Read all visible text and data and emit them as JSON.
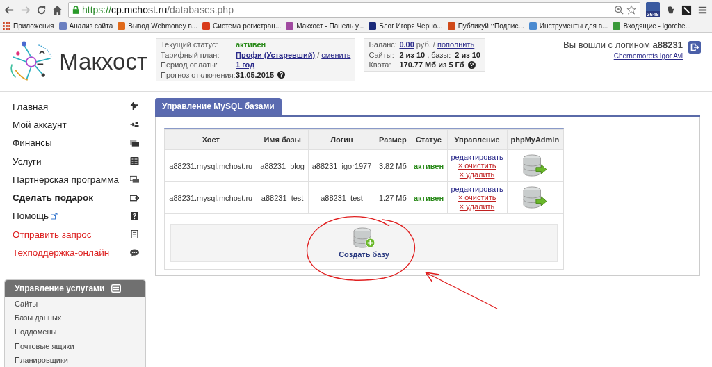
{
  "browser": {
    "url_scheme": "https://",
    "url_host": "cp.mchost.ru",
    "url_path": "/databases.php",
    "extension_badge": "2646",
    "bookmarks": [
      "Приложения",
      "Анализ сайта",
      "Вывод Webmoney в...",
      "Система регистрац...",
      "Макхост - Панель у...",
      "Блог Игоря Черно...",
      "Публикуй ::Подпис...",
      "Инструменты для в...",
      "Входящие - igorche..."
    ]
  },
  "header": {
    "logo": "Макхост",
    "account": [
      {
        "label": "Текущий статус:",
        "value": "активен",
        "kind": "status"
      },
      {
        "label": "Тарифный план:",
        "value": "Профи (Устаревший)",
        "separator": "/",
        "link": "сменить",
        "kind": "plan"
      },
      {
        "label": "Период оплаты:",
        "value": "1 год",
        "kind": "link"
      },
      {
        "label": "Прогноз отключения:",
        "value": "31.05.2015",
        "kind": "help"
      }
    ],
    "usage": [
      {
        "label": "Баланс:",
        "value": "0.00",
        "unit": "руб. /",
        "link": "пополнить",
        "kind": "balance"
      },
      {
        "label": "Сайты:",
        "value": "2 из 10",
        "extra": ", базы:",
        "value2": "2 из 10",
        "kind": "sites"
      },
      {
        "label": "Квота:",
        "value": "170.77 Мб из 5 Гб",
        "kind": "help"
      }
    ],
    "login_text": "Вы вошли с логином",
    "login": "a88231",
    "user_name": "Chernomorets Igor Avi"
  },
  "sidebar": {
    "menu": [
      {
        "label": "Главная",
        "kind": "normal",
        "external": false
      },
      {
        "label": "Мой аккаунт",
        "kind": "normal",
        "external": false
      },
      {
        "label": "Финансы",
        "kind": "normal",
        "external": false
      },
      {
        "label": "Услуги",
        "kind": "normal",
        "external": false
      },
      {
        "label": "Партнерская программа",
        "kind": "normal",
        "external": false
      },
      {
        "label": "Сделать подарок",
        "kind": "bold",
        "external": false
      },
      {
        "label": "Помощь",
        "kind": "normal",
        "external": true
      },
      {
        "label": "Отправить запрос",
        "kind": "alert",
        "external": false
      },
      {
        "label": "Техподдержка-онлайн",
        "kind": "alert",
        "external": false
      }
    ],
    "services": {
      "title": "Управление услугами",
      "items": [
        "Сайты",
        "Базы данных",
        "Поддомены",
        "Почтовые ящики",
        "Планировщики"
      ]
    }
  },
  "panel": {
    "tab": "Управление MySQL базами",
    "table": {
      "columns": [
        "Хост",
        "Имя базы",
        "Логин",
        "Размер",
        "Статус",
        "Управление",
        "phpMyAdmin"
      ],
      "rows": [
        {
          "host": "a88231.mysql.mchost.ru",
          "name": "a88231_blog",
          "login": "a88231_igor1977",
          "size": "3.82 Мб",
          "status": "активен",
          "actions": [
            "редактировать",
            "× очистить",
            "× удалить"
          ]
        },
        {
          "host": "a88231.mysql.mchost.ru",
          "name": "a88231_test",
          "login": "a88231_test",
          "size": "1.27 Мб",
          "status": "активен",
          "actions": [
            "редактировать",
            "× очистить",
            "× удалить"
          ]
        }
      ]
    },
    "create_button": "Создать базу"
  }
}
